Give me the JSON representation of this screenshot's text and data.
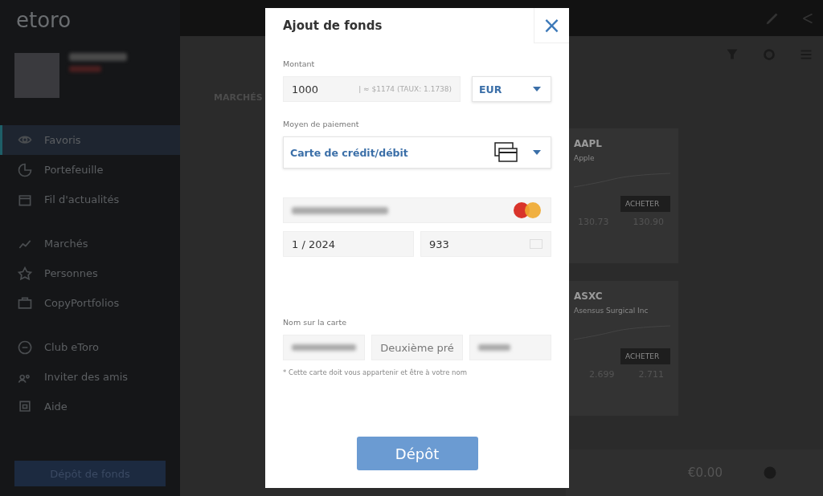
{
  "logo": "etoro",
  "sidebar": {
    "items": [
      {
        "label": "Favoris",
        "selected": true
      },
      {
        "label": "Portefeuille",
        "selected": false
      },
      {
        "label": "Fil d'actualités",
        "selected": false
      },
      {
        "label": "Marchés",
        "selected": false
      },
      {
        "label": "Personnes",
        "selected": false
      },
      {
        "label": "CopyPortfolios",
        "selected": false
      },
      {
        "label": "Club eToro",
        "selected": false
      },
      {
        "label": "Inviter des amis",
        "selected": false
      },
      {
        "label": "Aide",
        "selected": false
      }
    ],
    "deposit_button": "Dépôt de fonds"
  },
  "main": {
    "section": "MARCHÉS",
    "cards": [
      {
        "symbol": "AAPL",
        "name": "Apple",
        "sell": "130.73",
        "buy_label": "ACHETER",
        "buy": "130.90"
      },
      {
        "symbol": "ASXC",
        "name": "Asensus Surgical Inc",
        "sell": "2.699",
        "buy_label": "ACHETER",
        "buy": "2.711"
      }
    ],
    "footer": {
      "value": "€0.00"
    }
  },
  "dialog": {
    "title": "Ajout de fonds",
    "close": "×",
    "amount_label": "Montant",
    "amount": "1000",
    "conversion": "| ≈ $1174   (TAUX: 1.1738)",
    "currency": "EUR",
    "method_label": "Moyen de paiement",
    "method": "Carte de crédit/débit",
    "expiry": "1 / 2024",
    "cvv": "933",
    "name_label": "Nom sur la carte",
    "middle_name_placeholder": "Deuxième pré",
    "note": "* Cette carte doit vous appartenir et être à votre nom",
    "submit": "Dépôt"
  }
}
